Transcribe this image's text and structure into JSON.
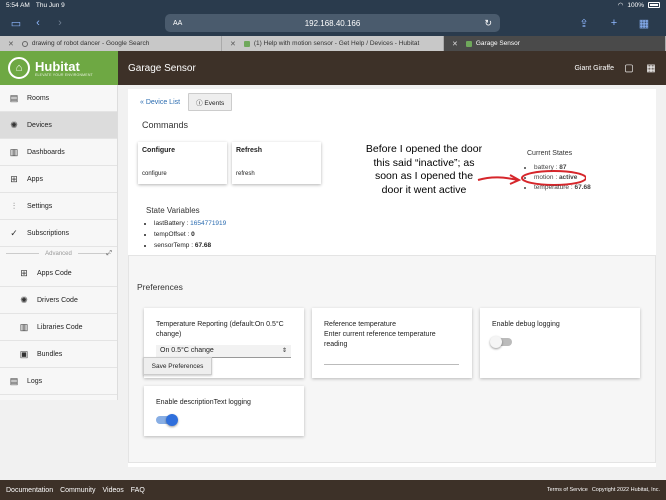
{
  "status_bar": {
    "time": "5:54 AM",
    "date": "Thu Jun 9",
    "battery": "100%"
  },
  "browser": {
    "aa": "AA",
    "url": "192.168.40.166",
    "tabs": [
      {
        "label": "drawing of robot dancer - Google Search"
      },
      {
        "label": "(1) Help with motion sensor - Get Help / Devices - Hubitat"
      },
      {
        "label": "Garage Sensor"
      }
    ]
  },
  "brand": {
    "name": "Hubitat",
    "tagline": "ELEVATE YOUR ENVIRONMENT"
  },
  "header": {
    "title": "Garage Sensor",
    "user": "Giant Giraffe"
  },
  "sidebar": {
    "items": [
      {
        "label": "Rooms",
        "icon": "rooms-icon"
      },
      {
        "label": "Devices",
        "icon": "devices-icon"
      },
      {
        "label": "Dashboards",
        "icon": "dashboards-icon"
      },
      {
        "label": "Apps",
        "icon": "apps-icon"
      },
      {
        "label": "Settings",
        "icon": "settings-icon"
      },
      {
        "label": "Subscriptions",
        "icon": "subscriptions-icon"
      }
    ],
    "advanced_label": "Advanced",
    "advanced_items": [
      {
        "label": "Apps Code",
        "icon": "apps-code-icon"
      },
      {
        "label": "Drivers Code",
        "icon": "drivers-code-icon"
      },
      {
        "label": "Libraries Code",
        "icon": "libraries-code-icon"
      },
      {
        "label": "Bundles",
        "icon": "bundles-icon"
      }
    ],
    "logs_label": "Logs"
  },
  "main": {
    "device_list_link": "« Device List",
    "events_button": "ⓘ Events",
    "commands_heading": "Commands",
    "commands": [
      {
        "title": "Configure",
        "button": "configure"
      },
      {
        "title": "Refresh",
        "button": "refresh"
      }
    ],
    "state_variables_heading": "State Variables",
    "state_variables": {
      "lastBattery_key": "lastBattery : ",
      "lastBattery_val": "1654771919",
      "tempOffset_key": "tempOffset : ",
      "tempOffset_val": "0",
      "sensorTemp_key": "sensorTemp : ",
      "sensorTemp_val": "67.68"
    },
    "current_states_heading": "Current States",
    "current_states": [
      {
        "key": "battery : ",
        "val": "87"
      },
      {
        "key": "motion : ",
        "val": "active"
      },
      {
        "key": "temperature : ",
        "val": "67.68"
      }
    ],
    "annotation": "Before I opened the door this said “inactive”; as soon as I opened the door it went active"
  },
  "preferences": {
    "heading": "Preferences",
    "temp_reporting_label": "Temperature Reporting (default:On 0.5°C change)",
    "temp_reporting_value": "On 0.5°C change",
    "reference_temp_label": "Reference temperature",
    "reference_temp_desc": "Enter current reference temperature reading",
    "debug_logging_label": "Enable debug logging",
    "debug_logging_on": false,
    "desc_logging_label": "Enable descriptionText logging",
    "desc_logging_on": true,
    "save_button": "Save Preferences"
  },
  "footer": {
    "links": [
      "Documentation",
      "Community",
      "Videos",
      "FAQ"
    ],
    "terms": "Terms of Service",
    "copyright": "Copyright 2022 Hubitat, Inc."
  }
}
